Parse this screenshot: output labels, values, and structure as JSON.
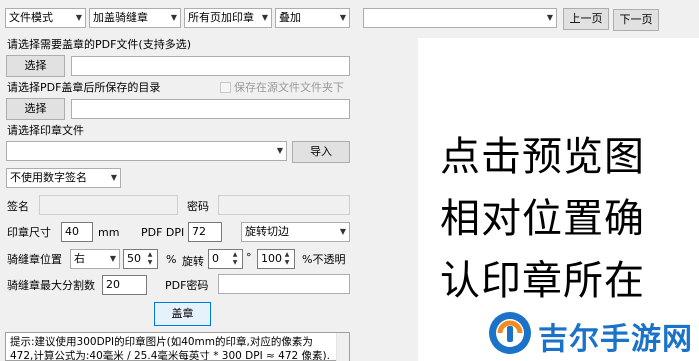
{
  "toolbar": {
    "mode": "文件模式",
    "seam_type": "加盖骑缝章",
    "page_range": "所有页加印章",
    "overlay": "叠加",
    "page_select": "",
    "prev_page": "上一页",
    "next_page": "下一页"
  },
  "pdf_input": {
    "label": "请选择需要盖章的PDF文件(支持多选)",
    "button": "选择",
    "value": ""
  },
  "save_dir": {
    "label": "请选择PDF盖章后所保存的目录",
    "checkbox_label": "保存在源文件文件夹下",
    "checkbox_checked": false,
    "button": "选择",
    "value": ""
  },
  "stamp_file": {
    "label": "请选择印章文件",
    "value": "",
    "import_button": "导入"
  },
  "digital_sign": {
    "value": "不使用数字签名"
  },
  "signature": {
    "name_label": "签名",
    "name_value": "",
    "password_label": "密码",
    "password_value": ""
  },
  "stamp_size": {
    "label": "印章尺寸",
    "value": "40",
    "unit": "mm",
    "dpi_label": "PDF DPI",
    "dpi_value": "72",
    "rotate_mode": "旋转切边"
  },
  "seam_position": {
    "label": "骑缝章位置",
    "side": "右",
    "offset": "50",
    "offset_unit": "%",
    "rotate_label": "旋转",
    "rotate_value": "0",
    "rotate_unit": "°",
    "opacity_value": "100",
    "opacity_unit": "%不透明"
  },
  "max_split": {
    "label": "骑缝章最大分割数",
    "value": "20",
    "pdf_password_label": "PDF密码",
    "pdf_password_value": ""
  },
  "stamp_button": "盖章",
  "hint": {
    "line1": "提示:建议使用300DPI的印章图片(如40mm的印章,对应的像素为",
    "line2": "472,计算公式为:40毫米 / 25.4毫米每英寸 * 300 DPI ≈ 472 像素)."
  },
  "preview": {
    "lines": [
      "点击预览图",
      "相对位置确",
      "认印章所在"
    ]
  },
  "watermark": {
    "text": "吉尔手游网"
  },
  "colors": {
    "accent": "#0078d7",
    "watermark": "#1a73c9"
  }
}
